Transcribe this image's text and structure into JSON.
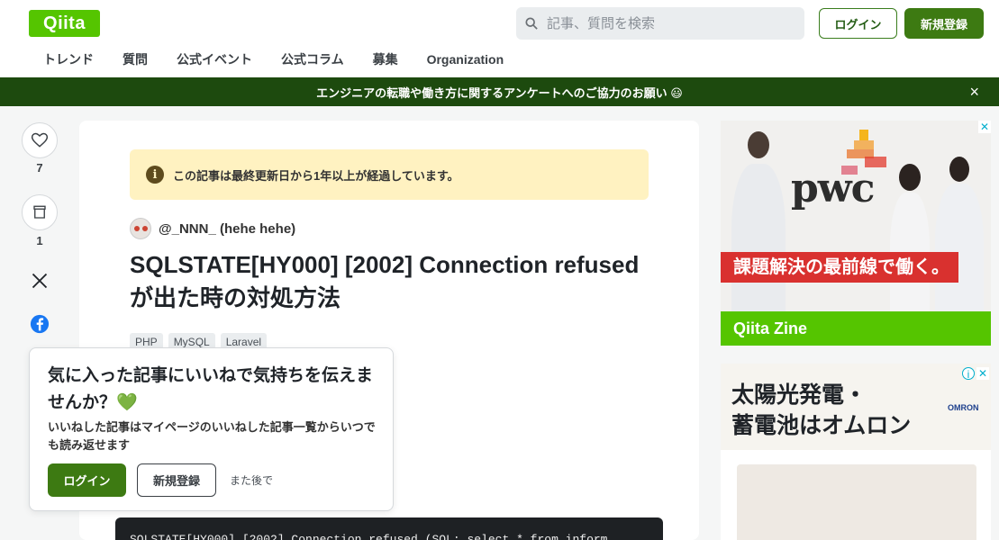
{
  "header": {
    "logo": "Qiita",
    "search_placeholder": "記事、質問を検索",
    "login": "ログイン",
    "signup": "新規登録",
    "nav": [
      "トレンド",
      "質問",
      "公式イベント",
      "公式コラム",
      "募集",
      "Organization"
    ]
  },
  "banner": {
    "text": "エンジニアの転職や働き方に関するアンケートへのご協力のお願い 😃",
    "close": "×"
  },
  "rail": {
    "likes": "7",
    "stocks": "1"
  },
  "article": {
    "notice": "この記事は最終更新日から1年以上が経過しています。",
    "author": "@_NNN_ (hehe hehe)",
    "title": "SQLSTATE[HY000] [2002] Connection refused が出た時の対処方法",
    "tags": [
      "PHP",
      "MySQL",
      "Laravel"
    ],
    "code": "SQLSTATE[HY000] [2002] Connection refused (SQL: select * from inform"
  },
  "popup": {
    "title": "気に入った記事にいいねで気持ちを伝えませんか？💚",
    "desc": "いいねした記事はマイページのいいねした記事一覧からいつでも読み返せます",
    "login": "ログイン",
    "signup": "新規登録",
    "later": "また後で"
  },
  "ads": {
    "ad1_brand": "pwc",
    "ad1_catch": "課題解決の最前線で働く。",
    "ad1_footer": "Qiita Zine",
    "ad2_text_line1": "太陽光発電・",
    "ad2_text_line2": "蓄電池はオムロン",
    "ad2_brand": "OMRON"
  },
  "colors": {
    "qiita_green": "#55c500",
    "dark_green": "#3d7a12",
    "banner_bg": "#1d4a0e",
    "notice_bg": "#fff2c1",
    "pwc_red": "#d9312f"
  }
}
